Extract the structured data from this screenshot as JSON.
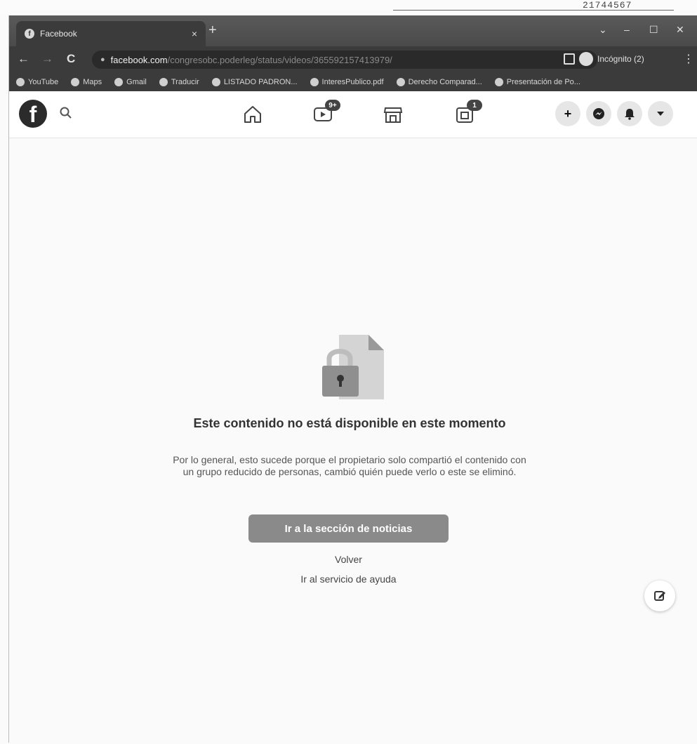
{
  "paper": {
    "corner_text": "21744567"
  },
  "browser": {
    "tab_title": "Facebook",
    "tab_close": "×",
    "new_tab": "+",
    "window_controls": [
      "⌄",
      "–",
      "☐",
      "✕"
    ],
    "nav": {
      "back": "←",
      "forward": "→",
      "reload": "C"
    },
    "url_host": "facebook.com",
    "url_path": "/congresobc.poderleg/status/videos/365592157413979/",
    "star": "☆",
    "incognito_label": "Incógnito (2)",
    "menu": "⋮",
    "bookmarks": [
      "YouTube",
      "Maps",
      "Gmail",
      "Traducir",
      "LISTADO PADRON...",
      "InteresPublico.pdf",
      "Derecho Comparad...",
      "Presentación de Po..."
    ]
  },
  "facebook": {
    "logo": "f",
    "watch_badge": "9+",
    "gaming_badge": "1",
    "create_label": "+"
  },
  "error": {
    "title": "Este contenido no está disponible en este momento",
    "description": "Por lo general, esto sucede porque el propietario solo compartió el contenido con un grupo reducido de personas, cambió quién puede verlo o este se eliminó.",
    "primary_button": "Ir a la sección de noticias",
    "back_link": "Volver",
    "help_link": "Ir al servicio de ayuda"
  },
  "colors": {
    "chrome_dark": "#3b3b3b",
    "button_gray": "#8a8a8a",
    "page_bg": "#fafafa"
  }
}
